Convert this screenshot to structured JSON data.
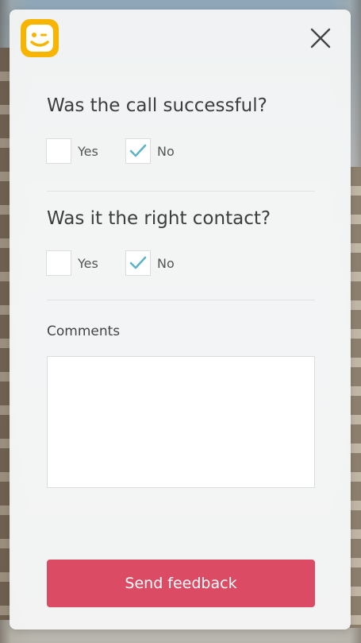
{
  "colors": {
    "accent": "#dc4b64",
    "check": "#5fb3c7",
    "logo": "#f7b500",
    "text": "#3d3d3d"
  },
  "header": {
    "logo_icon": "smiley-wink-icon",
    "close_icon": "close-icon"
  },
  "questions": [
    {
      "title": "Was the call successful?",
      "options": [
        {
          "label": "Yes",
          "checked": false
        },
        {
          "label": "No",
          "checked": true
        }
      ]
    },
    {
      "title": "Was it the right contact?",
      "options": [
        {
          "label": "Yes",
          "checked": false
        },
        {
          "label": "No",
          "checked": true
        }
      ]
    }
  ],
  "comments": {
    "label": "Comments",
    "value": ""
  },
  "submit": {
    "label": "Send feedback"
  }
}
